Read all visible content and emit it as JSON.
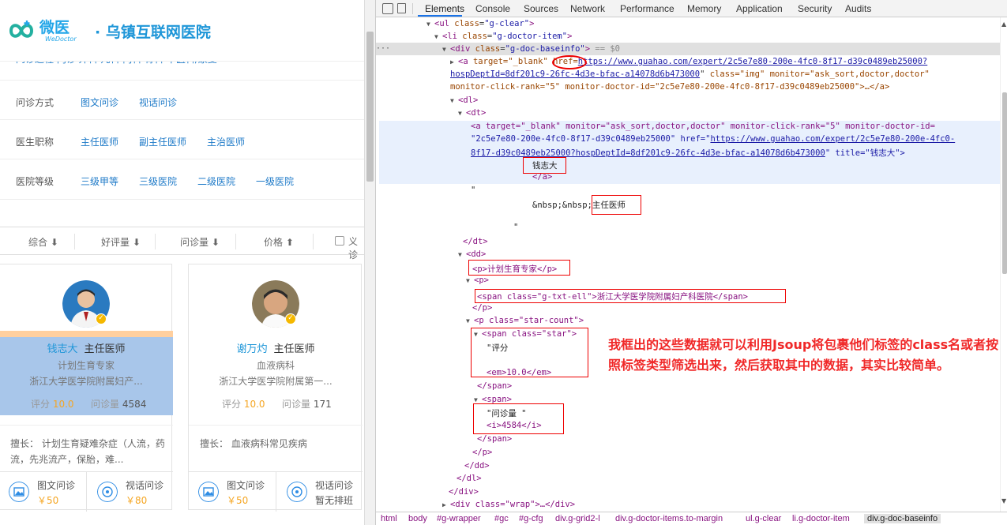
{
  "site": {
    "logo_cn": "微医",
    "logo_en": "WeDoctor",
    "hospital_name": "· 乌镇互联网医院",
    "partial_row_text": "问诊过程  门诊  外科  儿科  内科  骨科  中医科/康复",
    "filters": [
      {
        "label": "问诊方式",
        "options": [
          "图文问诊",
          "视话问诊"
        ]
      },
      {
        "label": "医生职称",
        "options": [
          "主任医师",
          "副主任医师",
          "主治医师"
        ]
      },
      {
        "label": "医院等级",
        "options": [
          "三级甲等",
          "三级医院",
          "二级医院",
          "一级医院"
        ]
      }
    ],
    "sort": {
      "items": [
        "综合 ⬇",
        "好评量 ⬇",
        "问诊量 ⬇",
        "价格 ⬆"
      ],
      "checkbox_label": "义诊"
    },
    "cards": [
      {
        "name": "钱志大",
        "title": "主任医师",
        "dept": "计划生育专家",
        "hospital": "浙江大学医学院附属妇产...",
        "rating_label": "评分",
        "rating": "10.0",
        "count_label": "问诊量",
        "count": "4584",
        "specialty": "擅长： 计划生育疑难杂症（人流，药流，先兆流产，保胎，难...",
        "services": [
          {
            "name": "图文问诊",
            "price": "￥50"
          },
          {
            "name": "视话问诊",
            "price": "￥80"
          }
        ]
      },
      {
        "name": "谢万灼",
        "title": "主任医师",
        "dept": "血液病科",
        "hospital": "浙江大学医学院附属第一...",
        "rating_label": "评分",
        "rating": "10.0",
        "count_label": "问诊量",
        "count": "171",
        "specialty": "擅长： 血液病科常见疾病",
        "services": [
          {
            "name": "图文问诊",
            "price": "￥50"
          },
          {
            "name": "视话问诊",
            "price": "暂无排班"
          }
        ]
      }
    ]
  },
  "devtools": {
    "tabs": [
      "Elements",
      "Console",
      "Sources",
      "Network",
      "Performance",
      "Memory",
      "Application",
      "Security",
      "Audits"
    ],
    "active_tab": "Elements",
    "dom": {
      "l1_tag": "<ul",
      "l1_attr": "class",
      "l1_val": "\"g-clear\"",
      "l2_tag": "<li",
      "l2_val": "\"g-doctor-item\"",
      "l3_tag": "<div",
      "l3_val": "\"g-doc-baseinfo\"",
      "l3_suffix": "== $0",
      "l4_a": "<a",
      "l4_target": "target=\"_blank\"",
      "l4_href": "href=",
      "l4_url": "https://www.guahao.com/expert/2c5e7e80-200e-4fc0-8f17-d39c0489eb25000?",
      "l4_url2": "hospDeptId=8df201c9-26fc-4d3e-bfac-a14078d6b473000",
      "l4_rest": "class=\"img\" monitor=\"ask_sort,doctor,doctor\"",
      "l4_rest2": "monitor-click-rank=\"5\" monitor-doctor-id=\"2c5e7e80-200e-4fc0-8f17-d39c0489eb25000\">…</a>",
      "dl_open": "<dl>",
      "dt_open": "<dt>",
      "a2_line1": "<a target=\"_blank\" monitor=\"ask_sort,doctor,doctor\" monitor-click-rank=\"5\" monitor-doctor-id=",
      "a2_line2a": "\"2c5e7e80-200e-4fc0-8f17-d39c0489eb25000\" href=\"",
      "a2_line2_url": "https://www.guahao.com/expert/2c5e7e80-200e-4fc0-",
      "a2_line3_url": "8f17-d39c0489eb25000?hospDeptId=8df201c9-26fc-4d3e-bfac-a14078d6b473000",
      "a2_line3_rest": "\" title=\"钱志大\">",
      "a2_text": "钱志大",
      "a2_close": "</a>",
      "quote1": "\"",
      "nbsp_text": "&nbsp;&nbsp;主任医师",
      "quote2": "\"",
      "dt_close": "</dt>",
      "dd_open": "<dd>",
      "p1": "<p>计划生育专家</p>",
      "p2_open": "<p>",
      "span_hosp": "<span class=\"g-txt-ell\">浙江大学医学院附属妇产科医院</span>",
      "p2_close": "</p>",
      "p3_open": "<p class=\"star-count\">",
      "star_open": "<span class=\"star\">",
      "star_text": "\"评分",
      "star_em": "<em>10.0</em>",
      "star_close": "</span>",
      "span2_open": "<span>",
      "count_text": "\"问诊量 \"",
      "count_i": "<i>4584</i>",
      "span2_close": "</span>",
      "p3_close": "</p>",
      "dd_close": "</dd>",
      "dl_close": "</dl>",
      "div_close": "</div>",
      "wrap": "<div class=\"wrap\">…</div>"
    },
    "annotation": "我框出的这些数据就可以利用Jsoup将包裹他们标签的class名或者按照标签类型筛选出来，然后获取其中的数据，其实比较简单。",
    "breadcrumbs": [
      "html",
      "body",
      "#g-wrapper",
      "#gc",
      "#g-cfg",
      "div.g-grid2-l",
      "div.g-doctor-items.to-margin",
      "ul.g-clear",
      "li.g-doctor-item",
      "div.g-doc-baseinfo"
    ]
  }
}
